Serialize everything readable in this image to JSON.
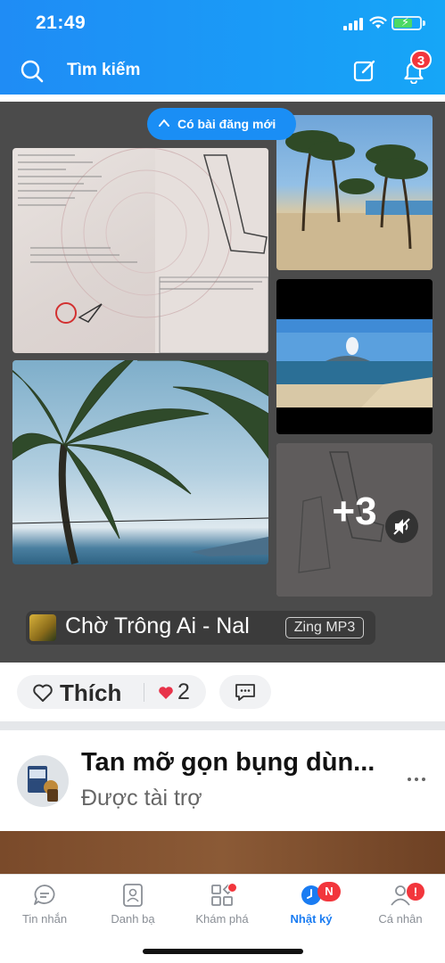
{
  "status_bar": {
    "time": "21:49"
  },
  "header": {
    "search_label": "Tìm kiếm",
    "notification_count": "3",
    "background": "#1a94f6"
  },
  "post": {
    "new_posts_pill": "Có bài đăng mới",
    "more_photos_label": "+3",
    "music": {
      "title": "Chờ Trông Ai - Nal",
      "source_badge": "Zing MP3"
    },
    "actions": {
      "like_label": "Thích",
      "reaction_count": "2"
    }
  },
  "sponsored": {
    "title": "Tan mỡ gọn bụng dùn...",
    "subtitle": "Được tài trợ"
  },
  "tabbar": {
    "tabs": [
      {
        "label": "Tin nhắn",
        "icon": "chat-icon"
      },
      {
        "label": "Danh bạ",
        "icon": "contacts-icon"
      },
      {
        "label": "Khám phá",
        "icon": "grid-icon"
      },
      {
        "label": "Nhật ký",
        "icon": "clock-icon",
        "badge": "N"
      },
      {
        "label": "Cá nhân",
        "icon": "person-icon",
        "badge": "!"
      }
    ],
    "active_color": "#1a7cf2",
    "badge_color": "#f2363c"
  }
}
